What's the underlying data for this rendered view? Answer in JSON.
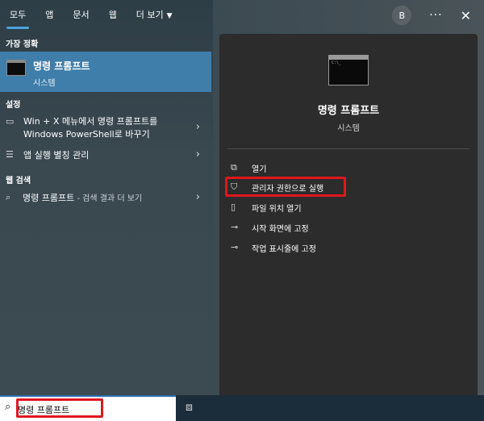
{
  "tabs": [
    {
      "label": "모두"
    },
    {
      "label": "앱"
    },
    {
      "label": "문서"
    },
    {
      "label": "웹"
    },
    {
      "label": "더 보기"
    }
  ],
  "user_initial": "B",
  "more_label": "···",
  "close_label": "✕",
  "left": {
    "best_match_title": "가장 정확",
    "best_match_item": {
      "title": "명령 프롬프트",
      "subtitle": "시스템"
    },
    "settings_title": "설정",
    "settings_items": [
      {
        "line1": "Win + X 메뉴에서 명령 프롬프트를",
        "line2": "Windows PowerShell로 바꾸기"
      },
      {
        "line1": "앱 실행 별칭 관리"
      }
    ],
    "web_title": "웹 검색",
    "web_item": {
      "query": "명령 프롬프트",
      "suffix": " - 검색 결과 더 보기"
    }
  },
  "right": {
    "app_title": "명령 프롬프트",
    "app_subtitle": "시스템",
    "actions": [
      {
        "label": "열기",
        "icon": "open-icon"
      },
      {
        "label": "관리자 권한으로 실행",
        "icon": "shield-icon"
      },
      {
        "label": "파일 위치 열기",
        "icon": "file-icon"
      },
      {
        "label": "시작 화면에 고정",
        "icon": "pin-icon"
      },
      {
        "label": "작업 표시줄에 고정",
        "icon": "pin-icon"
      }
    ]
  },
  "search": {
    "value": "명령 프롬프트"
  },
  "colors": {
    "accent": "#4aa3df",
    "highlight_border": "#e0161e",
    "selected_bg": "#3f7eaa"
  }
}
